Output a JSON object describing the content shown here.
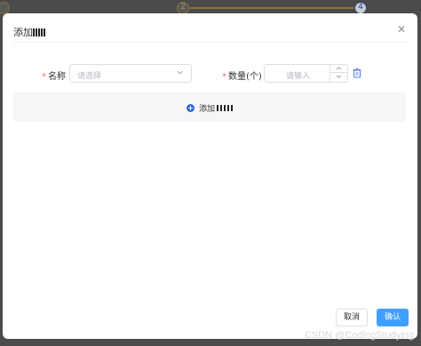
{
  "background_steps": {
    "step_2": "2",
    "step_4": "4"
  },
  "dialog": {
    "title": "添加",
    "close_icon": "close-icon"
  },
  "form": {
    "name_label": "名称",
    "name_placeholder": "请选择",
    "quantity_label": "数量(个)",
    "quantity_placeholder": "请输入",
    "required_mark": "*"
  },
  "add_row": {
    "label": "添加"
  },
  "footer": {
    "cancel_label": "取消",
    "confirm_label": "确认"
  },
  "watermark": "CSDN @CodingStudying",
  "colors": {
    "primary": "#409eff",
    "required": "#f56c6c",
    "add_icon": "#2f66d6"
  }
}
